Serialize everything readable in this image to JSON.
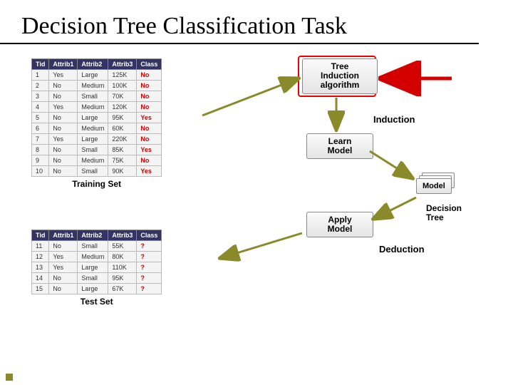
{
  "title": "Decision Tree Classification Task",
  "labels": {
    "training": "Training Set",
    "test": "Test Set",
    "induction": "Induction",
    "deduction": "Deduction",
    "decision_tree_1": "Decision",
    "decision_tree_2": "Tree"
  },
  "boxes": {
    "algo_l1": "Tree",
    "algo_l2": "Induction",
    "algo_l3": "algorithm",
    "learn_l1": "Learn",
    "learn_l2": "Model",
    "apply_l1": "Apply",
    "apply_l2": "Model",
    "model": "Model"
  },
  "headers": [
    "Tid",
    "Attrib1",
    "Attrib2",
    "Attrib3",
    "Class"
  ],
  "training_rows": [
    [
      "1",
      "Yes",
      "Large",
      "125K",
      "No"
    ],
    [
      "2",
      "No",
      "Medium",
      "100K",
      "No"
    ],
    [
      "3",
      "No",
      "Small",
      "70K",
      "No"
    ],
    [
      "4",
      "Yes",
      "Medium",
      "120K",
      "No"
    ],
    [
      "5",
      "No",
      "Large",
      "95K",
      "Yes"
    ],
    [
      "6",
      "No",
      "Medium",
      "60K",
      "No"
    ],
    [
      "7",
      "Yes",
      "Large",
      "220K",
      "No"
    ],
    [
      "8",
      "No",
      "Small",
      "85K",
      "Yes"
    ],
    [
      "9",
      "No",
      "Medium",
      "75K",
      "No"
    ],
    [
      "10",
      "No",
      "Small",
      "90K",
      "Yes"
    ]
  ],
  "test_rows": [
    [
      "11",
      "No",
      "Small",
      "55K",
      "?"
    ],
    [
      "12",
      "Yes",
      "Medium",
      "80K",
      "?"
    ],
    [
      "13",
      "Yes",
      "Large",
      "110K",
      "?"
    ],
    [
      "14",
      "No",
      "Small",
      "95K",
      "?"
    ],
    [
      "15",
      "No",
      "Large",
      "67K",
      "?"
    ]
  ]
}
